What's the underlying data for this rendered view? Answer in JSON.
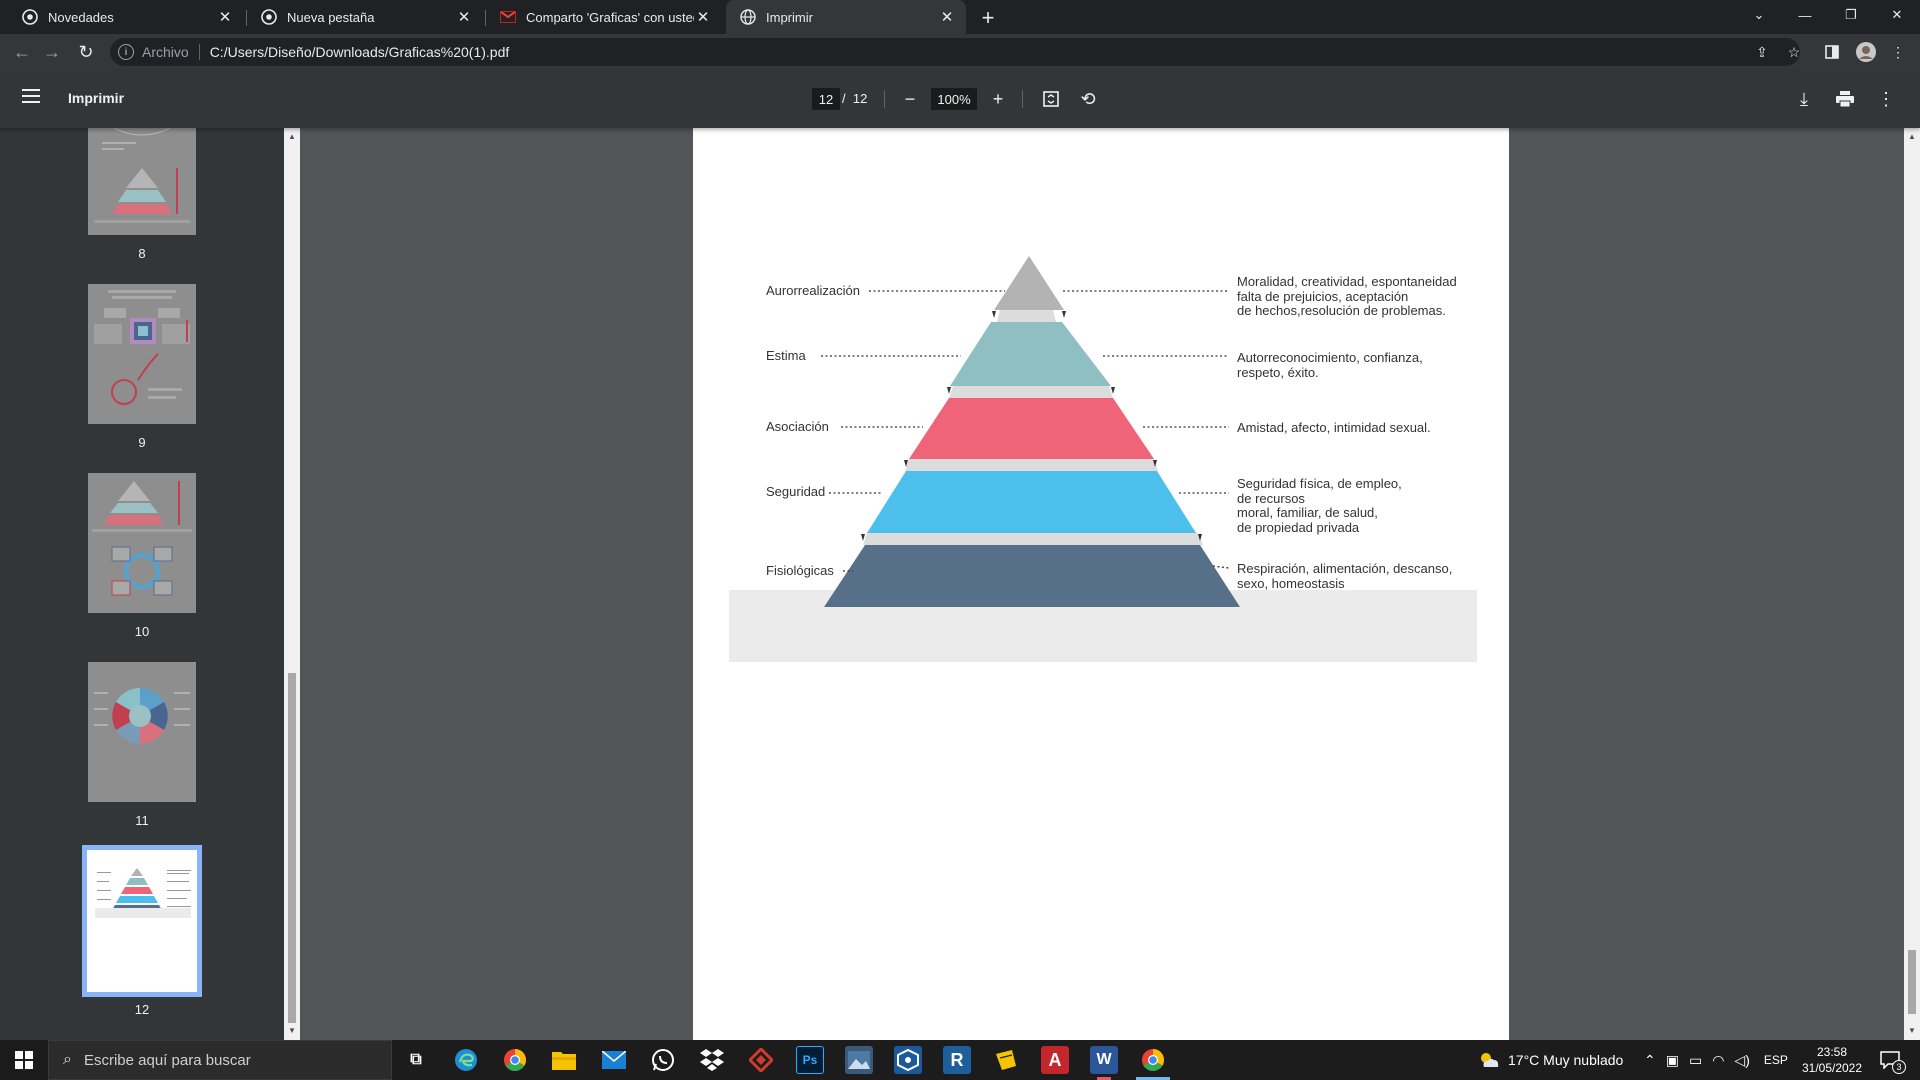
{
  "tabs": [
    {
      "label": "Novedades",
      "icon": "chrome-icon"
    },
    {
      "label": "Nueva pestaña",
      "icon": "chrome-icon"
    },
    {
      "label": "Comparto 'Graficas' con usted - ",
      "icon": "gmail-icon"
    },
    {
      "label": "Imprimir",
      "icon": "globe-icon"
    }
  ],
  "address": {
    "scheme": "Archivo",
    "url": "C:/Users/Diseño/Downloads/Graficas%20(1).pdf"
  },
  "pdf_toolbar": {
    "title": "Imprimir",
    "current_page": "12",
    "page_separator": "/",
    "total_pages": "12",
    "zoom": "100%"
  },
  "thumbnails": [
    {
      "number": "8"
    },
    {
      "number": "9"
    },
    {
      "number": "10"
    },
    {
      "number": "11"
    },
    {
      "number": "12"
    }
  ],
  "pyramid": {
    "colors": {
      "level1": "#b3b3b3",
      "level2": "#8fbec3",
      "level3": "#ef6478",
      "level4": "#4dbfec",
      "level5": "#56708a",
      "separator": "#dcdcdc",
      "base": "#ebebeb"
    },
    "levels": [
      {
        "name": "Aurorrealización",
        "description": [
          "Moralidad, creatividad, espontaneidad",
          "falta de prejuicios, aceptación",
          "de hechos,resolución de problemas."
        ]
      },
      {
        "name": "Estima",
        "description": [
          "Autorreconocimiento, confianza,",
          "respeto, éxito."
        ]
      },
      {
        "name": "Asociación",
        "description": [
          "Amistad, afecto, intimidad sexual."
        ]
      },
      {
        "name": "Seguridad",
        "description": [
          "Seguridad física, de empleo,",
          "de recursos",
          "moral, familiar, de salud,",
          "de propiedad privada"
        ]
      },
      {
        "name": "Fisiológicas",
        "description": [
          "Respiración, alimentación, descanso,",
          "sexo, homeostasis"
        ]
      }
    ]
  },
  "taskbar": {
    "search_placeholder": "Escribe aquí para buscar",
    "weather": "17°C  Muy nublado",
    "language": "ESP",
    "time": "23:58",
    "date": "31/05/2022",
    "notifications": "3"
  }
}
